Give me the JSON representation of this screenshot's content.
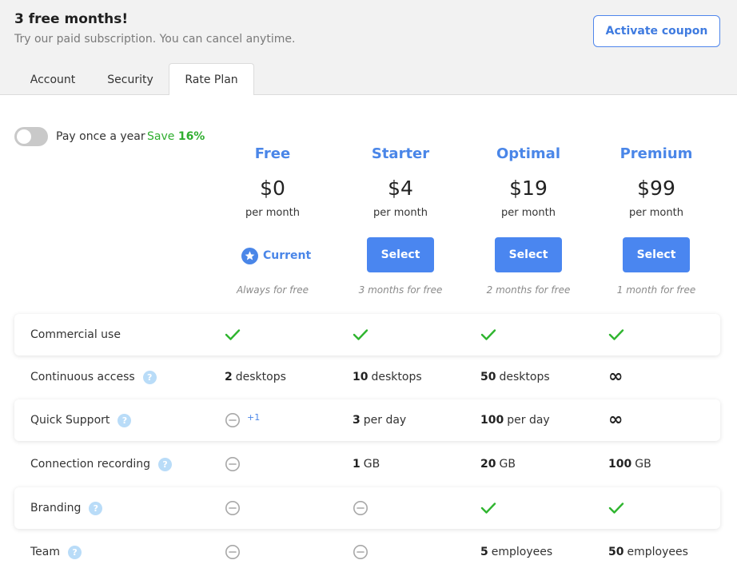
{
  "promo": {
    "title": "3 free months!",
    "subtitle": "Try our paid subscription. You can cancel anytime.",
    "coupon_button": "Activate coupon"
  },
  "tabs": [
    {
      "label": "Account",
      "active": false
    },
    {
      "label": "Security",
      "active": false
    },
    {
      "label": "Rate Plan",
      "active": true
    }
  ],
  "billing": {
    "toggle_on": false,
    "label": "Pay once a year",
    "save_prefix": "Save",
    "save_value": "16%"
  },
  "plans": [
    {
      "name": "Free",
      "price": "$0",
      "period": "per month",
      "action": "Current",
      "trial": "Always for free"
    },
    {
      "name": "Starter",
      "price": "$4",
      "period": "per month",
      "action": "Select",
      "trial": "3 months for free"
    },
    {
      "name": "Optimal",
      "price": "$19",
      "period": "per month",
      "action": "Select",
      "trial": "2 months for free"
    },
    {
      "name": "Premium",
      "price": "$99",
      "period": "per month",
      "action": "Select",
      "trial": "1 month for free"
    }
  ],
  "features": [
    {
      "label": "Commercial use",
      "help": false,
      "cells": [
        {
          "type": "check"
        },
        {
          "type": "check"
        },
        {
          "type": "check"
        },
        {
          "type": "check"
        }
      ]
    },
    {
      "label": "Continuous access",
      "help": true,
      "cells": [
        {
          "type": "value",
          "num": "2",
          "unit": "desktops"
        },
        {
          "type": "value",
          "num": "10",
          "unit": "desktops"
        },
        {
          "type": "value",
          "num": "50",
          "unit": "desktops"
        },
        {
          "type": "infinity",
          "symbol": "∞"
        }
      ]
    },
    {
      "label": "Quick Support",
      "help": true,
      "cells": [
        {
          "type": "none",
          "extra": "+1"
        },
        {
          "type": "value",
          "num": "3",
          "unit": "per day"
        },
        {
          "type": "value",
          "num": "100",
          "unit": "per day"
        },
        {
          "type": "infinity",
          "symbol": "∞"
        }
      ]
    },
    {
      "label": "Connection recording",
      "help": true,
      "cells": [
        {
          "type": "none"
        },
        {
          "type": "value",
          "num": "1",
          "unit": "GB"
        },
        {
          "type": "value",
          "num": "20",
          "unit": "GB"
        },
        {
          "type": "value",
          "num": "100",
          "unit": "GB"
        }
      ]
    },
    {
      "label": "Branding",
      "help": true,
      "cells": [
        {
          "type": "none"
        },
        {
          "type": "none"
        },
        {
          "type": "check"
        },
        {
          "type": "check"
        }
      ]
    },
    {
      "label": "Team",
      "help": true,
      "cells": [
        {
          "type": "none"
        },
        {
          "type": "none"
        },
        {
          "type": "value",
          "num": "5",
          "unit": "employees"
        },
        {
          "type": "value",
          "num": "50",
          "unit": "employees"
        }
      ]
    }
  ],
  "colors": {
    "accent": "#4a86e8",
    "button": "#4a86f0",
    "check": "#2fb52f",
    "save": "#2fae2f",
    "help": "#b9dcf8",
    "none": "#a8a8a8"
  },
  "icons": {
    "current": "star-badge-icon",
    "included": "check-icon",
    "not_included": "minus-circle-icon",
    "unlimited": "infinity-icon",
    "help": "question-icon",
    "help_glyph": "?"
  }
}
